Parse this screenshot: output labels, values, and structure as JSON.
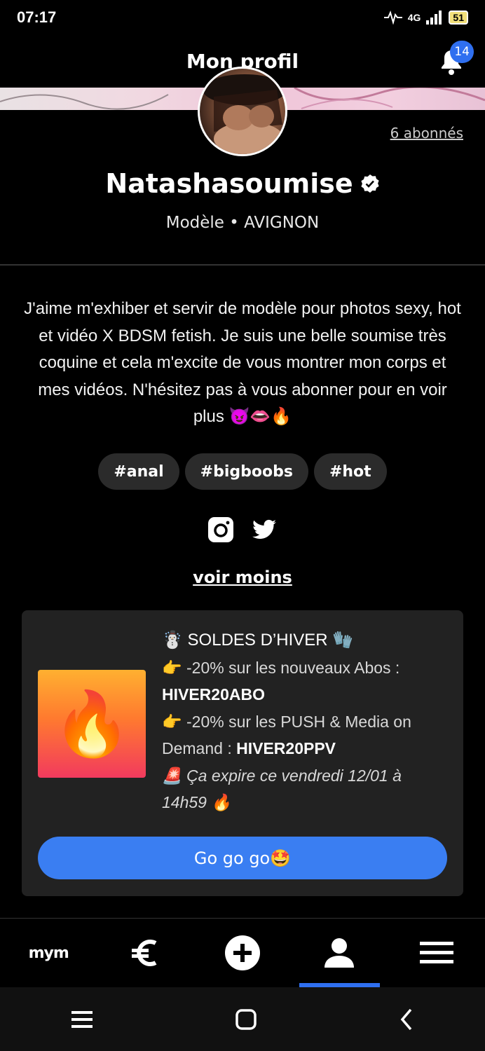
{
  "status": {
    "time": "07:17",
    "network": "4G",
    "battery": "51"
  },
  "header": {
    "title": "Mon profil",
    "notifications": "14"
  },
  "profile": {
    "followers": "6 abonnés",
    "username": "Natashasoumise",
    "subtitle": "Modèle • AVIGNON",
    "bio": "J'aime m'exhiber et servir de modèle pour photos sexy, hot et vidéo X BDSM fetish. Je suis une belle soumise très coquine et cela m'excite de vous montrer mon corps et mes vidéos. N'hésitez pas à vous abonner pour en voir plus 😈👄🔥",
    "tags": [
      "#anal",
      "#bigboobs",
      "#hot"
    ],
    "toggle_label": "voir moins"
  },
  "promo": {
    "image_emoji": "🔥",
    "title": "☃️ SOLDES D’HIVER 🧤",
    "line1": "👉 -20% sur les nouveaux Abos :",
    "code1": "HIVER20ABO",
    "line2": "👉 -20% sur les PUSH & Media on Demand :",
    "code2": "HIVER20PPV",
    "expiry": "🚨 Ça expire ce vendredi 12/01 à 14h59 🔥",
    "button_label": "Go go go🤩"
  },
  "tabbar": {
    "logo": "mym",
    "icons": [
      "mym-logo",
      "euro-icon",
      "plus-circle-icon",
      "user-icon",
      "menu-icon"
    ],
    "active_index": 3
  },
  "colors": {
    "accent": "#2f6ff0",
    "button": "#3a7ef2",
    "card": "#222222",
    "tag": "#2b2b2b"
  }
}
